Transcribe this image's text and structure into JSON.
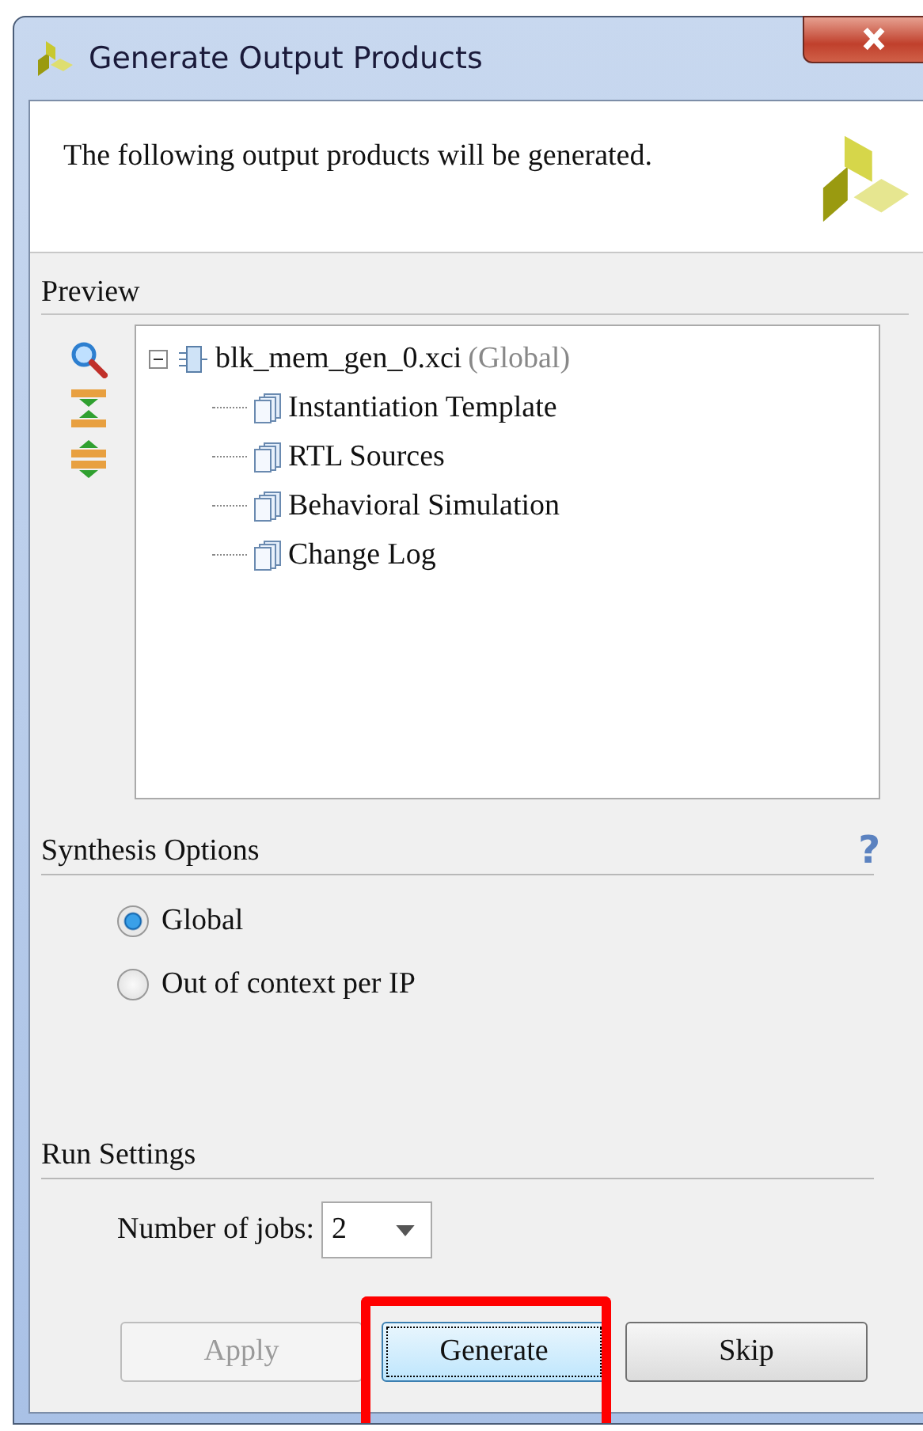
{
  "window": {
    "title": "Generate Output Products"
  },
  "header": {
    "message": "The following output products will be generated."
  },
  "preview": {
    "label": "Preview",
    "tree": {
      "name": "blk_mem_gen_0.xci",
      "note": "(Global)",
      "expanded": true,
      "children": [
        {
          "name": "Instantiation Template"
        },
        {
          "name": "RTL Sources"
        },
        {
          "name": "Behavioral Simulation"
        },
        {
          "name": "Change Log"
        }
      ]
    }
  },
  "synthesis_options": {
    "label": "Synthesis Options",
    "help": "?",
    "options": [
      {
        "label": "Global",
        "selected": true
      },
      {
        "label": "Out of context per IP",
        "selected": false
      }
    ]
  },
  "run_settings": {
    "label": "Run Settings",
    "jobs_label": "Number of jobs:",
    "jobs_value": "2"
  },
  "buttons": [
    {
      "label": "Apply",
      "disabled": true,
      "focused": false,
      "highlighted": false
    },
    {
      "label": "Generate",
      "disabled": false,
      "focused": true,
      "highlighted": true
    },
    {
      "label": "Skip",
      "disabled": false,
      "focused": false,
      "highlighted": false
    }
  ]
}
